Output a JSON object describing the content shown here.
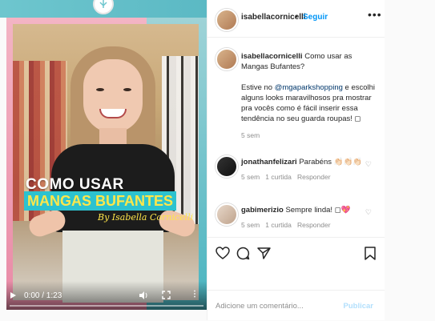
{
  "video": {
    "title_line1": "COMO USAR",
    "title_line2": "MANGAS BUFANTES",
    "byline": "By Isabella Cornicelli",
    "time": "0:00 / 1:23",
    "more_label": "⋮"
  },
  "header": {
    "username": "isabellacornicelli",
    "dot": "•",
    "follow": "Seguir",
    "more": "•••"
  },
  "caption": {
    "username": "isabellacornicelli",
    "title": "Como usar as Mangas Bufantes?",
    "before_mention": "Estive no ",
    "mention": "@mgaparkshopping",
    "after_mention": " e escolhi alguns looks maravilhosos pra mostrar pra vocês como é fácil inserir essa tendência no seu guarda roupas! ◻",
    "time": "5 sem"
  },
  "comments": [
    {
      "username": "jonathanfelizari",
      "text": "Parabéns 👏🏻👏🏻👏🏻",
      "time": "5 sem",
      "likes": "1 curtida",
      "reply": "Responder"
    },
    {
      "username": "gabimerizio",
      "text": "Sempre linda! ◻💖",
      "time": "5 sem",
      "likes": "1 curtida",
      "reply": "Responder"
    }
  ],
  "add_comment": {
    "placeholder": "Adicione um comentário...",
    "publish": "Publicar"
  },
  "colors": {
    "accent": "#0095f6",
    "title_band": "#2cc2cf",
    "title_text": "#ffe64a"
  }
}
